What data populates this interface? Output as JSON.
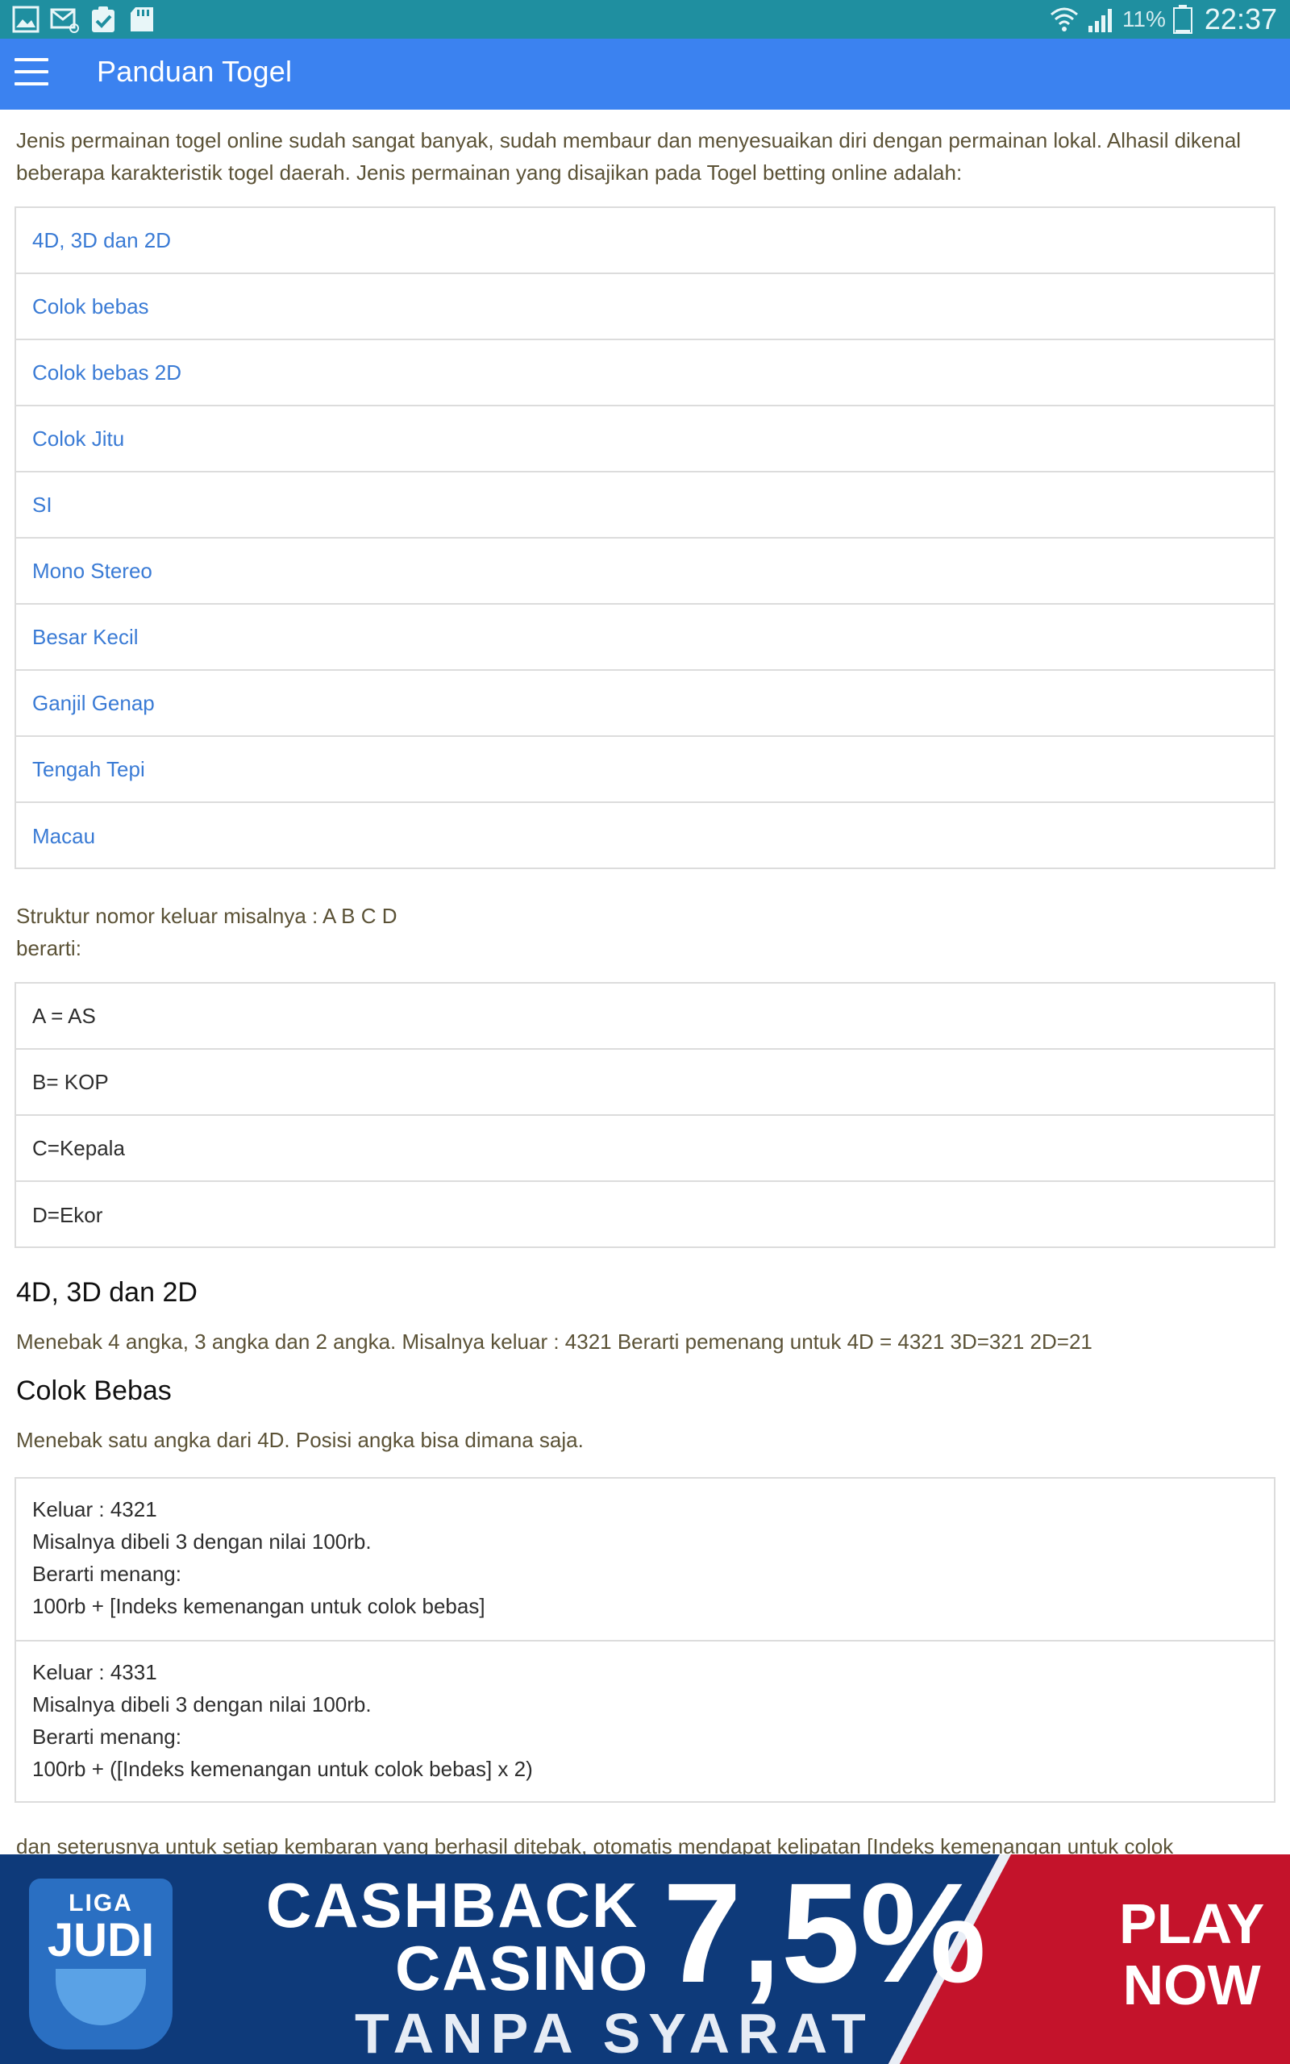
{
  "status_bar": {
    "icons": [
      "image-icon",
      "mail-icon",
      "clipboard-check-icon",
      "sd-card-icon"
    ],
    "battery_percent": "11%",
    "time": "22:37"
  },
  "app_bar": {
    "title": "Panduan Togel"
  },
  "content": {
    "intro": "Jenis permainan togel online sudah sangat banyak, sudah membaur dan menyesuaikan diri dengan permainan lokal. Alhasil dikenal beberapa karakteristik togel daerah. Jenis permainan yang disajikan pada Togel betting online adalah:",
    "game_links": [
      "4D, 3D dan 2D",
      "Colok bebas",
      "Colok bebas 2D",
      "Colok Jitu",
      "SI",
      "Mono Stereo",
      "Besar Kecil",
      "Ganjil Genap",
      "Tengah Tepi",
      "Macau"
    ],
    "structure_line1": "Struktur nomor keluar misalnya : A B C D",
    "structure_line2": "berarti:",
    "structure_items": [
      "A = AS",
      "B= KOP",
      "C=Kepala",
      "D=Ekor"
    ],
    "section_4d_title": "4D, 3D dan 2D",
    "section_4d_desc": "Menebak 4 angka, 3 angka dan 2 angka. Misalnya keluar : 4321 Berarti pemenang untuk 4D = 4321 3D=321 2D=21",
    "section_colok_title": "Colok Bebas",
    "section_colok_desc": "Menebak satu angka dari 4D. Posisi angka bisa dimana saja.",
    "examples": [
      {
        "line1": "Keluar : 4321",
        "line2": "Misalnya dibeli 3 dengan nilai 100rb.",
        "line3": "Berarti menang:",
        "line4": "100rb + [Indeks kemenangan untuk colok bebas]"
      },
      {
        "line1": "Keluar : 4331",
        "line2": "Misalnya dibeli 3 dengan nilai 100rb.",
        "line3": "Berarti menang:",
        "line4": "100rb + ([Indeks kemenangan untuk colok bebas] x 2)"
      }
    ],
    "tail": "dan seterusnya untuk setiap kembaran yang berhasil ditebak, otomatis mendapat kelipatan [Indeks kemenangan untuk colok"
  },
  "banner": {
    "logo_line1": "LIGA",
    "logo_line2": "JUDI",
    "cashback": "CASHBACK",
    "casino": "CASINO",
    "percent": "7,5%",
    "tanpa_syarat": "TANPA SYARAT",
    "play": "PLAY",
    "now": "NOW"
  },
  "colors": {
    "status_bar": "#1f8fa0",
    "app_bar": "#3b82f0",
    "link": "#3a7bd5",
    "body_text": "#5b5236",
    "banner_blue": "#0e3a7a",
    "banner_red": "#c4132b"
  }
}
